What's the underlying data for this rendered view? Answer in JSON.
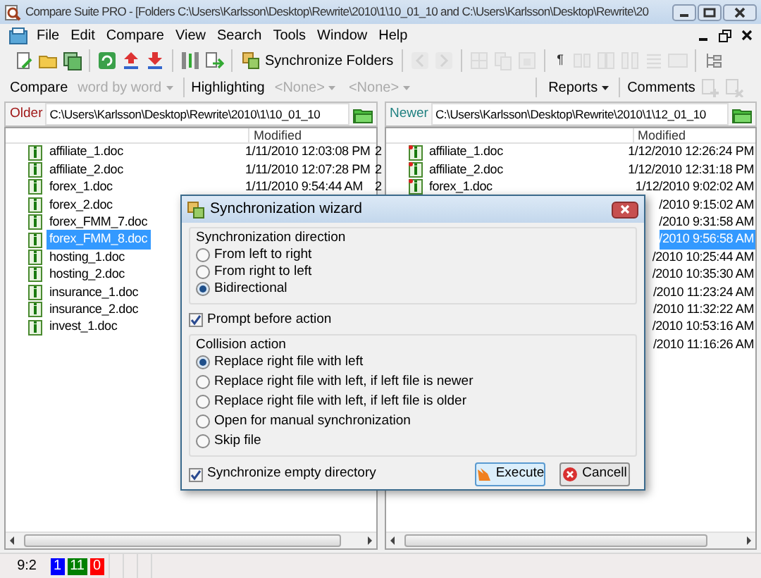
{
  "window": {
    "title": "Compare Suite PRO - [Folders C:\\Users\\Karlsson\\Desktop\\Rewrite\\2010\\1\\10_01_10 and C:\\Users\\Karlsson\\Desktop\\Rewrite\\20"
  },
  "menu": [
    "File",
    "Edit",
    "Compare",
    "View",
    "Search",
    "Tools",
    "Window",
    "Help"
  ],
  "toolbar": [
    {
      "kind": "icon",
      "disabled": false
    },
    {
      "kind": "icon",
      "disabled": false
    },
    {
      "kind": "icon",
      "disabled": false
    },
    {
      "kind": "sep"
    },
    {
      "kind": "icon",
      "disabled": false
    },
    {
      "kind": "icon",
      "disabled": false
    },
    {
      "kind": "icon",
      "disabled": false
    },
    {
      "kind": "sep"
    },
    {
      "kind": "icon",
      "disabled": false
    },
    {
      "kind": "icon",
      "disabled": false
    },
    {
      "kind": "sep"
    },
    {
      "kind": "label",
      "label": "Synchronize Folders",
      "disabled": false
    },
    {
      "kind": "sep"
    },
    {
      "kind": "icon",
      "disabled": true
    },
    {
      "kind": "icon",
      "disabled": true
    },
    {
      "kind": "sep"
    },
    {
      "kind": "icon",
      "disabled": true
    },
    {
      "kind": "icon",
      "disabled": true
    },
    {
      "kind": "icon",
      "disabled": true
    },
    {
      "kind": "sep"
    },
    {
      "kind": "glyph",
      "label": "¶",
      "disabled": false
    },
    {
      "kind": "icon",
      "disabled": true
    },
    {
      "kind": "icon",
      "disabled": true
    },
    {
      "kind": "icon",
      "disabled": true
    },
    {
      "kind": "icon",
      "disabled": true
    },
    {
      "kind": "icon",
      "disabled": true
    },
    {
      "kind": "sep"
    },
    {
      "kind": "icon",
      "disabled": false
    }
  ],
  "compare_bar": [
    {
      "kind": "label",
      "label": "Compare"
    },
    {
      "kind": "dropdown",
      "label": "word by word",
      "disabled": true
    },
    {
      "kind": "sep"
    },
    {
      "kind": "label",
      "label": "Highlighting"
    },
    {
      "kind": "dropdown",
      "label": "<None>",
      "disabled": true
    },
    {
      "kind": "dropdown",
      "label": "<None>",
      "disabled": true
    },
    {
      "kind": "gap"
    },
    {
      "kind": "dropdown",
      "label": "Reports",
      "disabled": false
    },
    {
      "kind": "sep"
    },
    {
      "kind": "label",
      "label": "Comments"
    },
    {
      "kind": "icon",
      "disabled": true
    },
    {
      "kind": "icon",
      "disabled": true
    }
  ],
  "left_panel": {
    "caption": "Older",
    "path": "C:\\Users\\Karlsson\\Desktop\\Rewrite\\2010\\1\\10_01_10",
    "columns": [
      "Modified"
    ],
    "rows": [
      {
        "name": "affiliate_1.doc",
        "modified": "1/11/2010 12:03:08 PM",
        "column_3": "2",
        "selected": false
      },
      {
        "name": "affiliate_2.doc",
        "modified": "1/11/2010 12:07:28 PM",
        "column_3": "2",
        "selected": false
      },
      {
        "name": "forex_1.doc",
        "modified": "1/11/2010 9:54:44 AM",
        "column_3": "2",
        "selected": false
      },
      {
        "name": "forex_2.doc",
        "selected": false
      },
      {
        "name": "forex_FMM_7.doc",
        "selected": false
      },
      {
        "name": "forex_FMM_8.doc",
        "selected": true
      },
      {
        "name": "hosting_1.doc",
        "selected": false
      },
      {
        "name": "hosting_2.doc",
        "selected": false
      },
      {
        "name": "insurance_1.doc",
        "selected": false
      },
      {
        "name": "insurance_2.doc",
        "selected": false
      },
      {
        "name": "invest_1.doc",
        "selected": false
      }
    ]
  },
  "right_panel": {
    "caption": "Newer",
    "path": "C:\\Users\\Karlsson\\Desktop\\Rewrite\\2010\\1\\12_01_10",
    "columns": [
      "Modified"
    ],
    "rows": [
      {
        "name": "affiliate_1.doc",
        "modified": "1/12/2010 12:26:24 PM",
        "selected": false
      },
      {
        "name": "affiliate_2.doc",
        "modified": "1/12/2010 12:31:18 PM",
        "selected": false
      },
      {
        "name": "forex_1.doc",
        "modified": "1/12/2010 9:02:02 AM",
        "selected": false
      },
      {
        "modified": "/2010 9:15:02 AM",
        "selected": false
      },
      {
        "modified": "/2010 9:31:58 AM",
        "selected": false
      },
      {
        "modified": "/2010 9:56:58 AM",
        "selected": true
      },
      {
        "modified": "/2010 10:25:44 AM",
        "selected": false
      },
      {
        "modified": "/2010 10:35:30 AM",
        "selected": false
      },
      {
        "modified": "/2010 11:23:24 AM",
        "selected": false
      },
      {
        "modified": "/2010 11:32:22 AM",
        "selected": false
      },
      {
        "modified": "/2010 10:53:16 AM",
        "selected": false
      },
      {
        "modified": "/2010 11:16:26 AM",
        "selected": false
      }
    ]
  },
  "dialog": {
    "title": "Synchronization wizard",
    "direction": {
      "title": "Synchronization direction",
      "options": [
        {
          "label": "From left to right",
          "selected": false
        },
        {
          "label": "From right to left",
          "selected": false
        },
        {
          "label": "Bidirectional",
          "selected": true
        }
      ]
    },
    "prompt": {
      "label": "Prompt before action",
      "checked": true
    },
    "collision": {
      "title": "Collision action",
      "options": [
        {
          "label": "Replace right file with left",
          "selected": true
        },
        {
          "label": "Replace right file with left, if left file is newer",
          "selected": false
        },
        {
          "label": "Replace right file with left, if left file is older",
          "selected": false
        },
        {
          "label": "Open for manual synchronization",
          "selected": false
        },
        {
          "label": "Skip file",
          "selected": false
        }
      ]
    },
    "empty_dirs": {
      "label": "Synchronize empty directory",
      "checked": true
    },
    "buttons": [
      {
        "kind": "execute",
        "label": "Execute"
      },
      {
        "kind": "cancel",
        "label": "Cancell"
      }
    ]
  },
  "status_bar": {
    "position": "9:2",
    "counters": [
      {
        "text": "1",
        "color": "#0000ff"
      },
      {
        "text": "11",
        "color": "#008000"
      },
      {
        "text": "0",
        "color": "#ff0000"
      }
    ]
  }
}
